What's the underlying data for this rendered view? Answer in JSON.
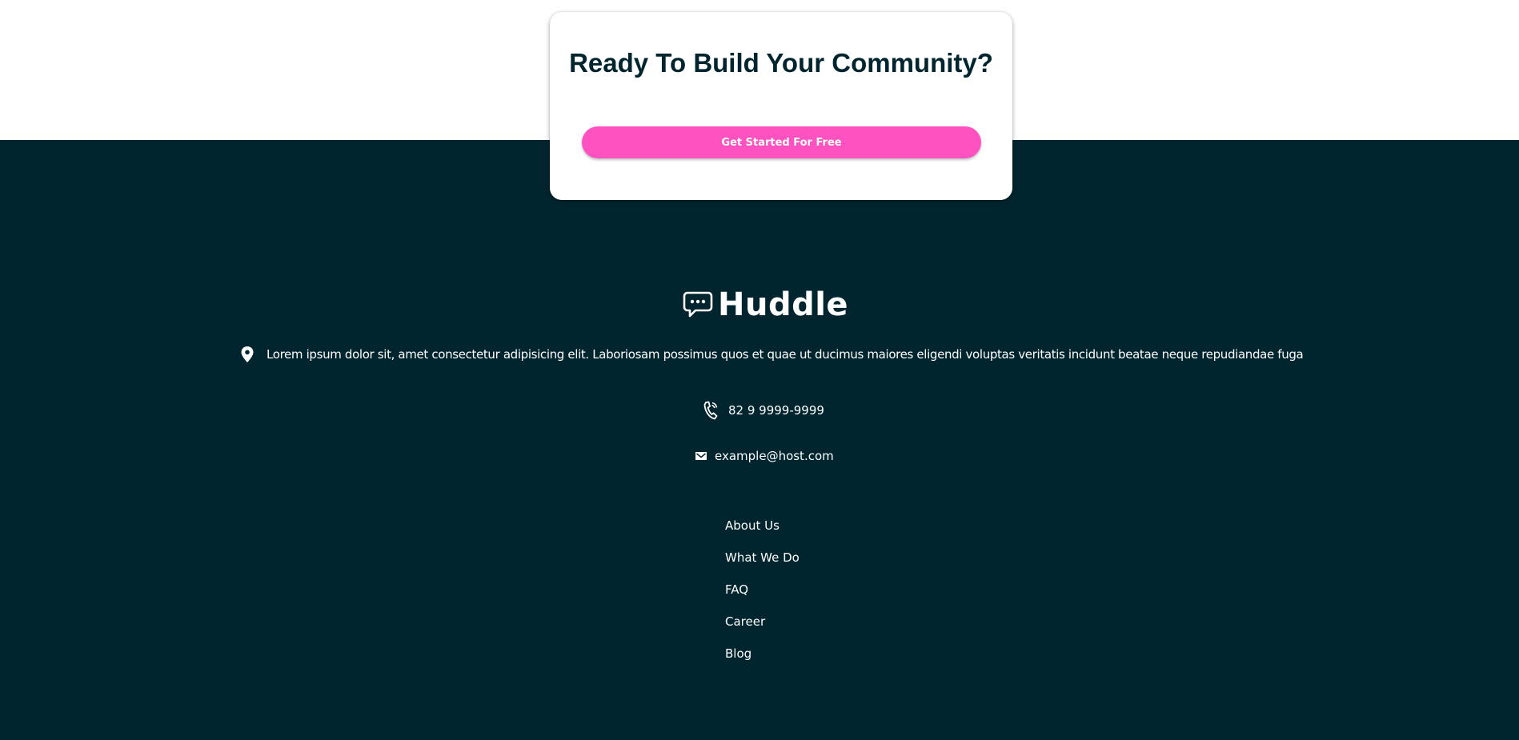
{
  "cta": {
    "title": "Ready To Build Your Community?",
    "button_label": "Get Started For Free"
  },
  "footer": {
    "brand": "Huddle",
    "address": "Lorem ipsum dolor sit, amet consectetur adipisicing elit. Laboriosam possimus quos et quae ut ducimus maiores eligendi voluptas veritatis incidunt beatae neque repudiandae fuga",
    "phone": "82 9 9999-9999",
    "email": "example@host.com",
    "nav": [
      {
        "label": "About Us"
      },
      {
        "label": "What We Do"
      },
      {
        "label": "FAQ"
      },
      {
        "label": "Career"
      },
      {
        "label": "Blog"
      }
    ]
  },
  "icons": {
    "logo": "chat-bubble-icon",
    "address": "location-pin-icon",
    "phone": "phone-icon",
    "email": "mail-icon"
  },
  "colors": {
    "footer_background": "#00252e",
    "accent": "#ff52c1",
    "heading": "#00252e",
    "text_light": "#ffffff",
    "card_background": "#ffffff"
  }
}
